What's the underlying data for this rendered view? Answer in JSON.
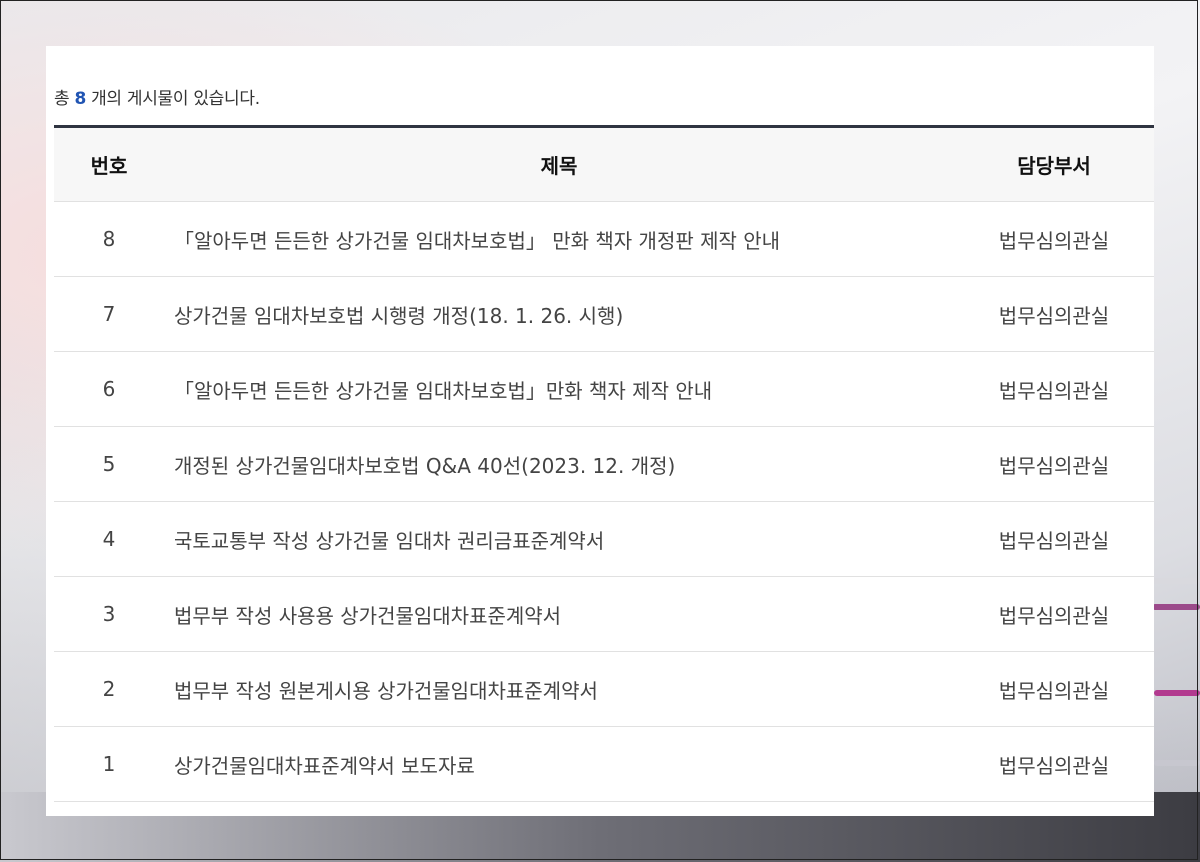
{
  "summary": {
    "prefix": "총",
    "count": "8",
    "suffix": "개의 게시물이 있습니다."
  },
  "table": {
    "headers": {
      "number": "번호",
      "title": "제목",
      "department": "담당부서"
    },
    "rows": [
      {
        "number": "8",
        "title": "「알아두면 든든한 상가건물 임대차보호법」 만화 책자 개정판 제작 안내",
        "department": "법무심의관실"
      },
      {
        "number": "7",
        "title": "상가건물 임대차보호법 시행령 개정(18. 1. 26. 시행)",
        "department": "법무심의관실"
      },
      {
        "number": "6",
        "title": "「알아두면 든든한 상가건물 임대차보호법」만화 책자 제작 안내",
        "department": "법무심의관실"
      },
      {
        "number": "5",
        "title": "개정된 상가건물임대차보호법 Q&A 40선(2023. 12. 개정)",
        "department": "법무심의관실"
      },
      {
        "number": "4",
        "title": "국토교통부 작성 상가건물 임대차 권리금표준계약서",
        "department": "법무심의관실"
      },
      {
        "number": "3",
        "title": "법무부 작성 사용용 상가건물임대차표준계약서",
        "department": "법무심의관실"
      },
      {
        "number": "2",
        "title": "법무부 작성 원본게시용 상가건물임대차표준계약서",
        "department": "법무심의관실"
      },
      {
        "number": "1",
        "title": "상가건물임대차표준계약서 보도자료",
        "department": "법무심의관실"
      }
    ]
  },
  "colors": {
    "count_accent": "#2155b3",
    "header_border": "#2f3441",
    "header_background": "#f7f7f7"
  }
}
